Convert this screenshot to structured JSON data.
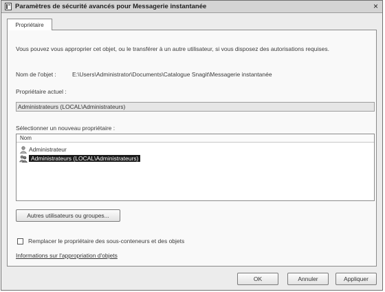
{
  "window": {
    "title": "Paramètres de sécurité avancés pour Messagerie instantanée",
    "close_glyph": "×"
  },
  "tabs": [
    {
      "label": "Propriétaire",
      "active": true
    }
  ],
  "content": {
    "intro": "Vous pouvez vous approprier cet objet, ou le transférer à un autre utilisateur, si vous disposez des autorisations requises.",
    "object_name_label": "Nom de l'objet :",
    "object_name_value": "E:\\Users\\Administrator\\Documents\\Catalogue Snagit\\Messagerie instantanée",
    "current_owner_label": "Propriétaire actuel :",
    "current_owner_value": "Administrateurs (LOCAL\\Administrateurs)",
    "new_owner_label": "Sélectionner un nouveau propriétaire :",
    "list": {
      "column_header": "Nom",
      "items": [
        {
          "label": "Administrateur",
          "icon": "user-icon",
          "selected": false
        },
        {
          "label": "Administrateurs (LOCAL\\Administrateurs)",
          "icon": "group-icon",
          "selected": true
        }
      ]
    },
    "other_users_button": "Autres utilisateurs ou groupes...",
    "replace_checkbox_label": "Remplacer le propriétaire des sous-conteneurs et des objets",
    "replace_checked": false,
    "info_link": "Informations sur l'appropriation d'objets"
  },
  "footer": {
    "ok": "OK",
    "cancel": "Annuler",
    "apply": "Appliquer"
  }
}
